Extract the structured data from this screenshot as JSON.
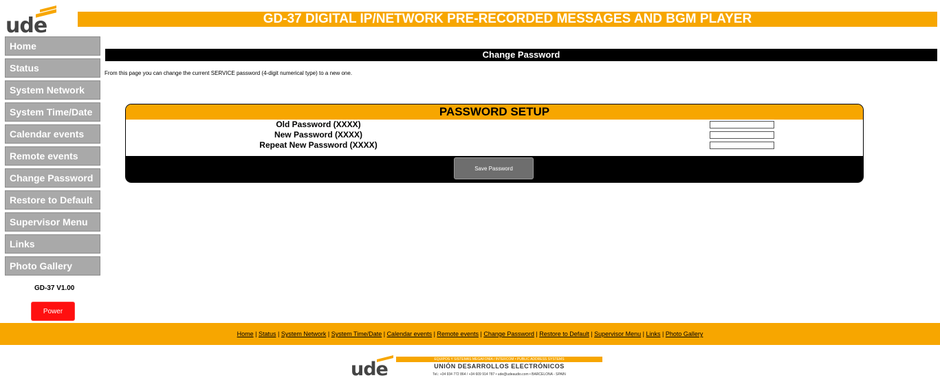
{
  "brand": {
    "logo_text": "ude"
  },
  "header": {
    "title": "GD-37 DIGITAL IP/NETWORK PRE-RECORDED MESSAGES AND BGM PLAYER"
  },
  "sidebar": {
    "items": [
      {
        "label": "Home"
      },
      {
        "label": "Status"
      },
      {
        "label": "System Network"
      },
      {
        "label": "System Time/Date"
      },
      {
        "label": "Calendar events"
      },
      {
        "label": "Remote events"
      },
      {
        "label": "Change Password"
      },
      {
        "label": "Restore to Default"
      },
      {
        "label": "Supervisor Menu"
      },
      {
        "label": "Links"
      },
      {
        "label": "Photo Gallery"
      }
    ],
    "version": "GD-37 V1.00",
    "power_label": "Power"
  },
  "page": {
    "title": "Change Password",
    "intro": "From this page you can change the current SERVICE password (4-digit numerical type) to a new one."
  },
  "form": {
    "heading": "PASSWORD SETUP",
    "fields": [
      {
        "label": "Old Password (XXXX)",
        "value": ""
      },
      {
        "label": "New Password (XXXX)",
        "value": ""
      },
      {
        "label": "Repeat New Password (XXXX)",
        "value": ""
      }
    ],
    "save_label": "Save Password"
  },
  "footer": {
    "links": [
      "Home",
      "Status",
      "System Network",
      "System Time/Date",
      "Calendar events",
      "Remote events",
      "Change Password",
      "Restore to Default",
      "Supervisor Menu",
      "Links",
      "Photo Gallery"
    ],
    "logo_tagline": "EQUIPOS Y SISTEMAS MEGAFONÍA / INTERCOM  •  PUBLIC ADDRESS SYSTEMS",
    "company": "UNIÓN DESARROLLOS ELECTRÓNICOS",
    "address": "Tel.: +34 934 772 864 / +34 609 914 787 • ude@udeaudio.com • BARCELONA - SPAIN"
  },
  "colors": {
    "accent": "#f7a600",
    "nav_bg": "#a9a9a9",
    "power": "#ff1010"
  }
}
